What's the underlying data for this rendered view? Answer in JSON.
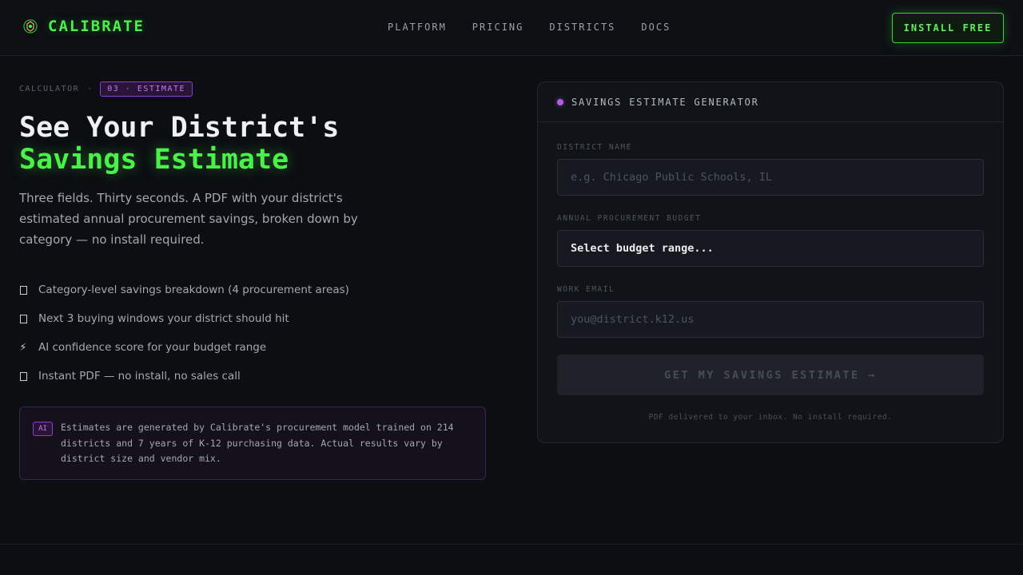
{
  "header": {
    "brand": "CALIBRATE",
    "nav": [
      "PLATFORM",
      "PRICING",
      "DISTRICTS",
      "DOCS"
    ],
    "cta_label": "INSTALL FREE"
  },
  "hero": {
    "crumb_label": "CALCULATOR",
    "crumb_sep": "·",
    "crumb_badge": "03 · ESTIMATE",
    "title_line1": "See Your District's",
    "title_line2": "Savings Estimate",
    "lede": "Three fields. Thirty seconds. A PDF with your district's estimated annual procurement savings, broken down by category — no install required.",
    "features": [
      {
        "icon": "checkbox-icon",
        "text": "Category-level savings breakdown (4 procurement areas)"
      },
      {
        "icon": "checkbox-icon",
        "text": "Next 3 buying windows your district should hit"
      },
      {
        "icon": "lightning-icon",
        "text": "AI confidence score for your budget range"
      },
      {
        "icon": "checkbox-icon",
        "text": "Instant PDF — no install, no sales call"
      }
    ],
    "note_badge": "AI",
    "note_text": "Estimates are generated by Calibrate's procurement model trained on 214 districts and 7 years of K-12 purchasing data. Actual results vary by district size and vendor mix."
  },
  "form": {
    "title": "SAVINGS ESTIMATE GENERATOR",
    "district_label": "DISTRICT NAME",
    "district_placeholder": "e.g. Chicago Public Schools, IL",
    "budget_label": "ANNUAL PROCUREMENT BUDGET",
    "budget_value": "Select budget range...",
    "email_label": "WORK EMAIL",
    "email_placeholder": "you@district.k12.us",
    "submit_label": "GET MY SAVINGS ESTIMATE →",
    "footer": "PDF delivered to your inbox. No install required."
  },
  "colors": {
    "accent_green": "#4cf04a",
    "accent_purple": "#b35cf0",
    "background": "#0c0e12"
  }
}
